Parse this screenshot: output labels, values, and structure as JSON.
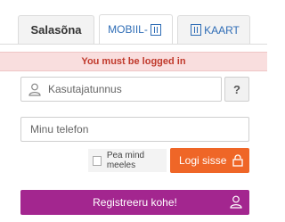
{
  "tabs": {
    "password": "Salasõna",
    "mobile": "MOBIIL-",
    "card": "KAART"
  },
  "alert": {
    "message": "You must be logged in"
  },
  "form": {
    "username_placeholder": "Kasutajatunnus",
    "help_label": "?",
    "phone_placeholder": "Minu telefon",
    "remember_label": "Pea mind meeles",
    "login_label": "Logi sisse"
  },
  "register": {
    "label": "Registreeru kohe!"
  },
  "colors": {
    "accent_orange": "#ef6627",
    "accent_purple": "#a3268f",
    "alert_bg": "#f9dede",
    "alert_text": "#c0392b",
    "tab_link": "#2f6db6"
  },
  "icons": [
    "user-icon",
    "id-card-icon",
    "lock-icon",
    "user-add-icon"
  ]
}
